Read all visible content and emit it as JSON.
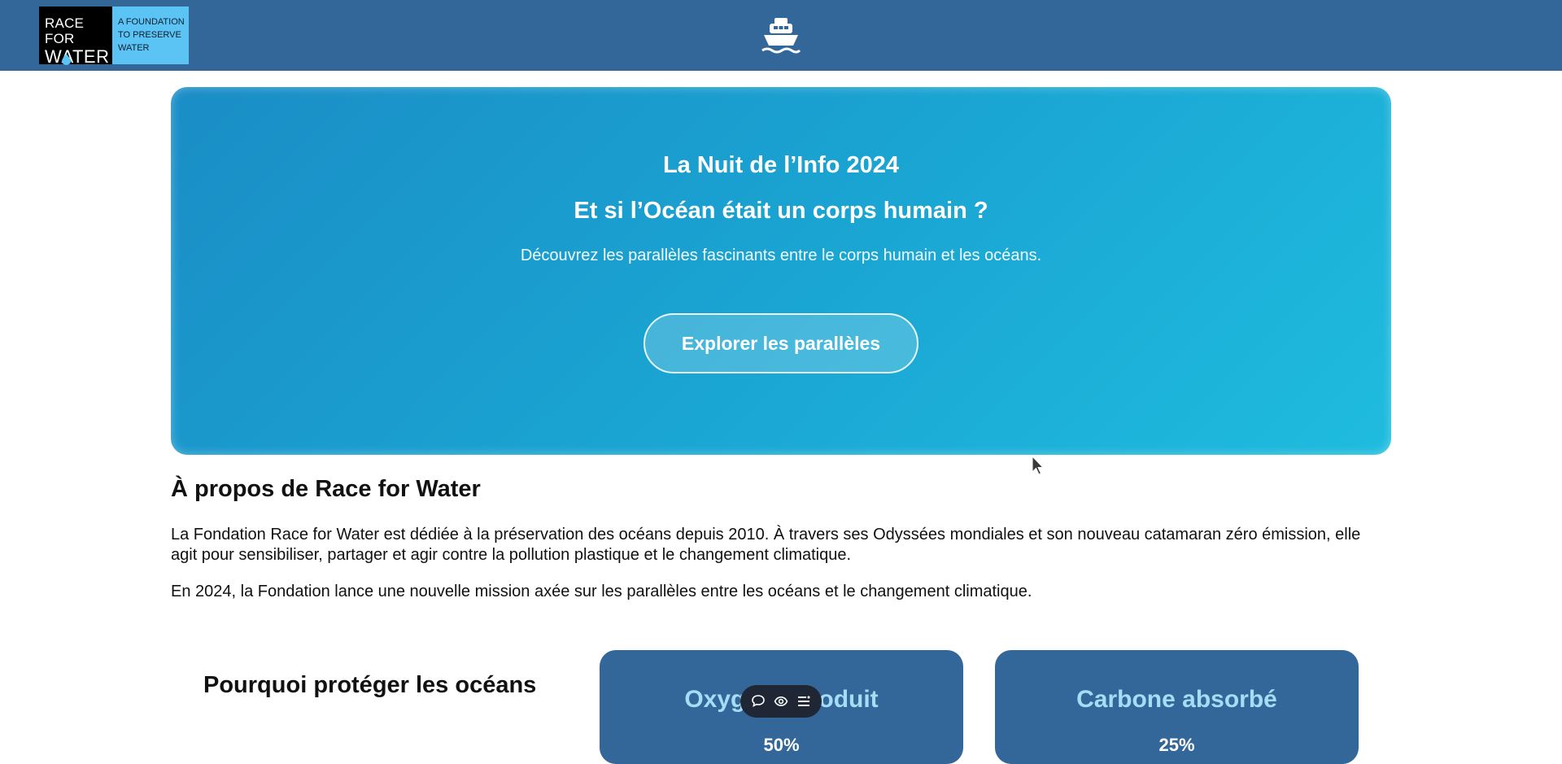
{
  "navbar": {
    "logo": {
      "line1": "RACE FOR",
      "line2": "WATER",
      "tagline": [
        "A FOUNDATION",
        "TO PRESERVE",
        "WATER"
      ]
    },
    "center_icon": "ship-icon"
  },
  "hero": {
    "title": "La Nuit de l’Info 2024",
    "subtitle": "Et si l’Océan était un corps humain ?",
    "description": "Découvrez les parallèles fascinants entre le corps humain et les océans.",
    "button_label": "Explorer les parallèles"
  },
  "about": {
    "title": "À propos de Race for Water",
    "paragraph1": "La Fondation Race for Water est dédiée à la préservation des océans depuis 2010. À travers ses Odyssées mondiales et son nouveau catamaran zéro émission, elle agit pour sensibiliser, partager et agir contre la pollution plastique et le changement climatique.",
    "paragraph2": "En 2024, la Fondation lance une nouvelle mission axée sur les parallèles entre les océans et le changement climatique."
  },
  "why": {
    "title": "Pourquoi protéger les océans",
    "cards": [
      {
        "title": "Oxygène produit",
        "value": "50%"
      },
      {
        "title": "Carbone absorbé",
        "value": "25%"
      }
    ]
  },
  "toolbar": {
    "icons": [
      "comment-icon",
      "eye-icon",
      "menu-icon"
    ]
  },
  "colors": {
    "navbar": "#336699",
    "hero_start": "#1a8dc6",
    "hero_end": "#1fbcde",
    "card": "#336699",
    "card_title": "#a6dcf5",
    "logo_accent": "#5bc4f5"
  }
}
